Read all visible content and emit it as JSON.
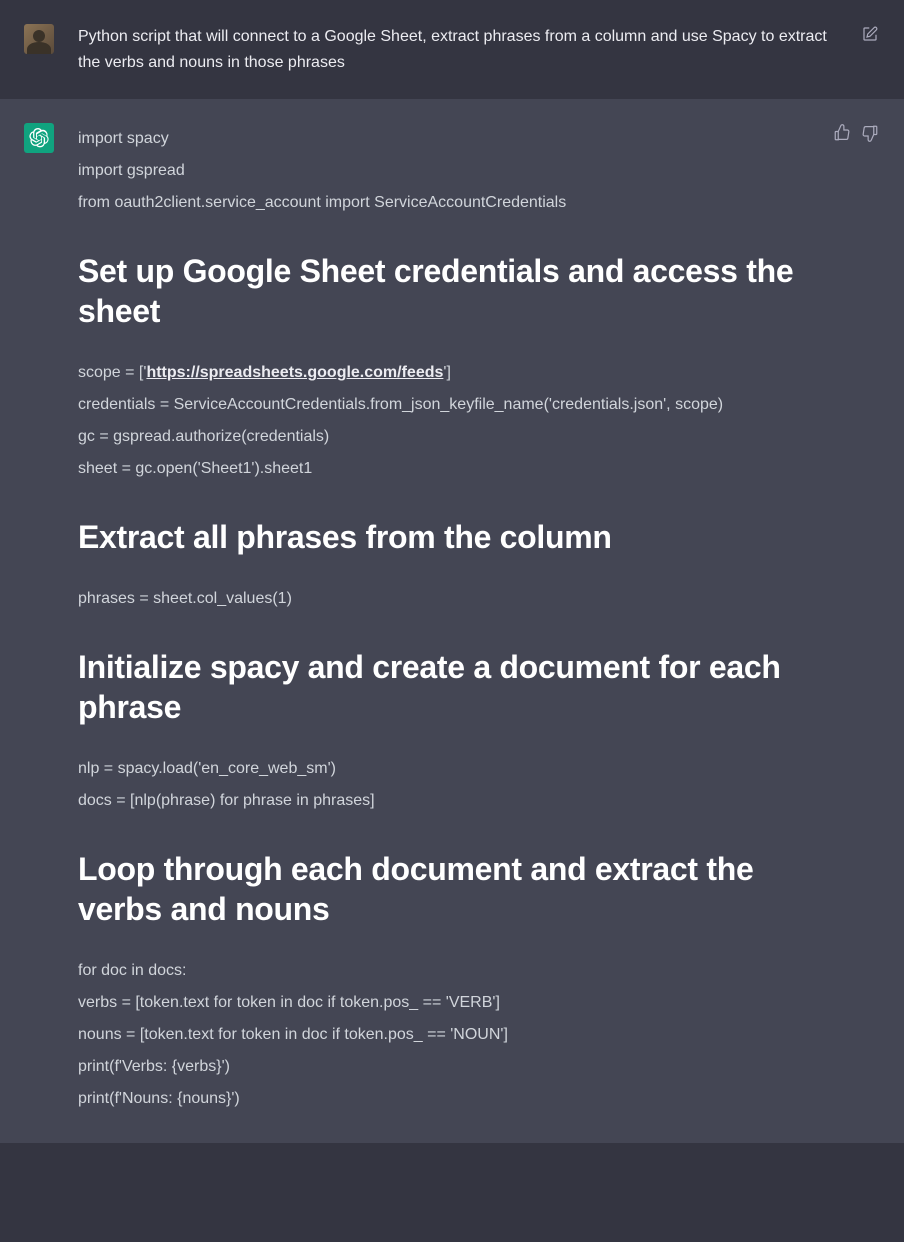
{
  "user": {
    "prompt": "Python script that will connect to a Google Sheet, extract phrases from a column and use Spacy to extract the verbs and nouns in those phrases"
  },
  "assistant": {
    "imports": [
      "import spacy",
      "import gspread",
      "from oauth2client.service_account import ServiceAccountCredentials"
    ],
    "sections": [
      {
        "heading": "Set up Google Sheet credentials and access the sheet",
        "lines": [
          {
            "pre": "scope = ['",
            "link": "https://spreadsheets.google.com/feeds",
            "post": "']"
          },
          {
            "text": "credentials = ServiceAccountCredentials.from_json_keyfile_name('credentials.json', scope)"
          },
          {
            "text": "gc = gspread.authorize(credentials)"
          },
          {
            "text": "sheet = gc.open('Sheet1').sheet1"
          }
        ]
      },
      {
        "heading": "Extract all phrases from the column",
        "lines": [
          {
            "text": "phrases = sheet.col_values(1)"
          }
        ]
      },
      {
        "heading": "Initialize spacy and create a document for each phrase",
        "lines": [
          {
            "text": "nlp = spacy.load('en_core_web_sm')"
          },
          {
            "text": "docs = [nlp(phrase) for phrase in phrases]"
          }
        ]
      },
      {
        "heading": "Loop through each document and extract the verbs and nouns",
        "lines": [
          {
            "text": "for doc in docs:"
          },
          {
            "text": "verbs = [token.text for token in doc if token.pos_ == 'VERB']"
          },
          {
            "text": "nouns = [token.text for token in doc if token.pos_ == 'NOUN']"
          },
          {
            "text": "print(f'Verbs: {verbs}')"
          },
          {
            "text": "print(f'Nouns: {nouns}')"
          }
        ]
      }
    ]
  }
}
